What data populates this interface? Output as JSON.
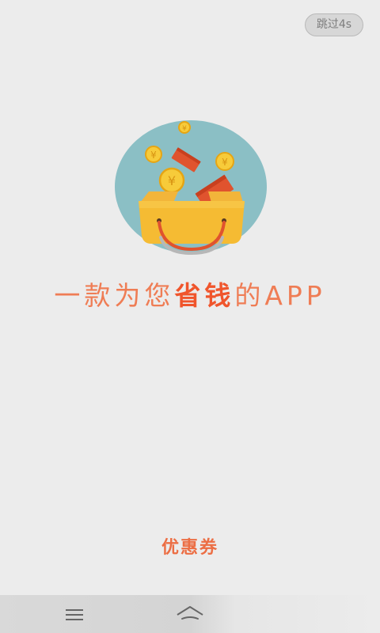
{
  "skip": {
    "label": "跳过4s"
  },
  "splash": {
    "tagline_before": "一款为您",
    "tagline_highlight": "省钱",
    "tagline_after": "的APP",
    "coin_symbol": "¥",
    "footer_label": "优惠券"
  },
  "navigation": {
    "menu_icon": "menu-icon",
    "home_icon": "home-icon"
  },
  "colors": {
    "background": "#ececec",
    "accent": "#ef7d55",
    "highlight": "#f0552c",
    "circle": "#8bbfc5",
    "bag": "#f5bb33",
    "coin": "#f7cb3a"
  }
}
